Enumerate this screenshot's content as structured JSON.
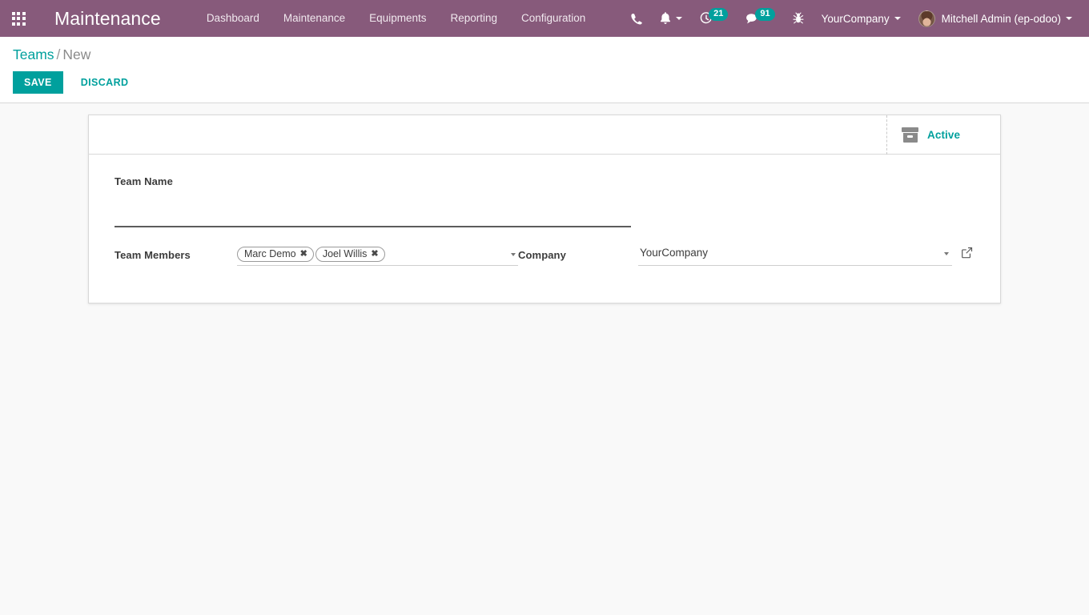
{
  "navbar": {
    "apps_icon": "apps-grid-icon",
    "brand": "Maintenance",
    "menu_items": [
      {
        "label": "Dashboard"
      },
      {
        "label": "Maintenance"
      },
      {
        "label": "Equipments"
      },
      {
        "label": "Reporting"
      },
      {
        "label": "Configuration"
      }
    ],
    "systray": {
      "phone_icon": "phone-icon",
      "bell_icon": "bell-icon",
      "activity_icon": "clock-activity-icon",
      "activity_count": "21",
      "messaging_icon": "chat-bubble-icon",
      "messaging_count": "91",
      "debug_icon": "bug-icon",
      "company": "YourCompany",
      "user": "Mitchell Admin (ep-odoo)",
      "avatar": "user-avatar"
    },
    "colors": {
      "navbar_bg": "#875A7B",
      "badge_bg": "#00A09D"
    }
  },
  "control_panel": {
    "breadcrumb": {
      "parent": "Teams",
      "separator": "/",
      "current": "New"
    },
    "save_label": "SAVE",
    "discard_label": "DISCARD",
    "accent_color": "#00A09D"
  },
  "form": {
    "button_box": {
      "active_icon": "archive-box-icon",
      "active_label": "Active"
    },
    "title_field": {
      "label": "Team Name",
      "value": "",
      "placeholder": ""
    },
    "fields": [
      {
        "label": "Team Members",
        "type": "many2many_tags",
        "tags": [
          {
            "name": "Marc Demo",
            "remove": "✖"
          },
          {
            "name": "Joel Willis",
            "remove": "✖"
          }
        ]
      },
      {
        "label": "Company",
        "type": "many2one",
        "value": "YourCompany",
        "external_link_icon": "external-link-icon"
      }
    ]
  }
}
